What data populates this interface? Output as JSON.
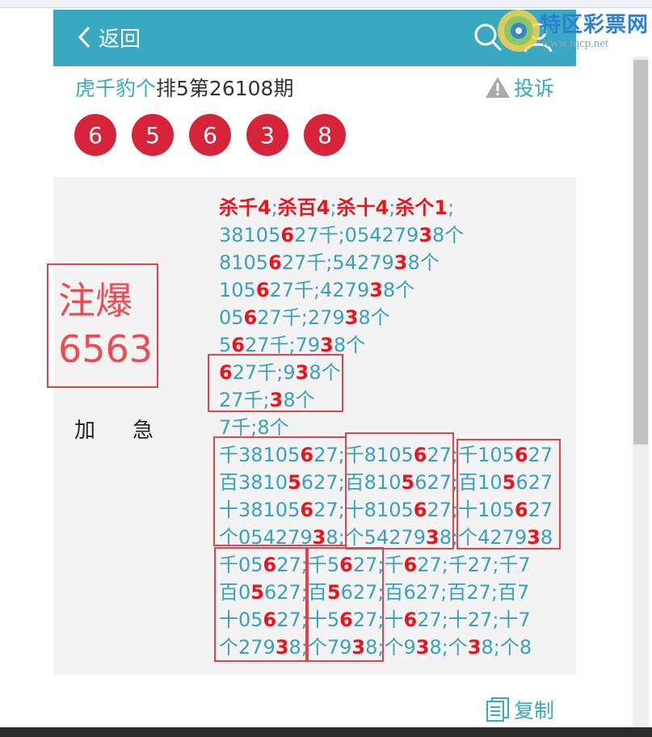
{
  "header": {
    "back_label": "返回"
  },
  "logo": {
    "name": "特区彩票网",
    "url": "www.tqcp.net"
  },
  "post": {
    "author": "虎千豹个",
    "title": "排5第26108期",
    "report_label": "投诉",
    "balls": [
      "6",
      "5",
      "6",
      "3",
      "8"
    ]
  },
  "badge": {
    "line1": "注爆",
    "line2": "6563"
  },
  "tags": [
    "加",
    "急"
  ],
  "lines": [
    [
      [
        "杀千4",
        true
      ],
      [
        ";",
        false
      ],
      [
        "杀百4",
        true
      ],
      [
        ";",
        false
      ],
      [
        "杀十4",
        true
      ],
      [
        ";",
        false
      ],
      [
        "杀个1",
        true
      ],
      [
        ";",
        false
      ]
    ],
    [
      [
        "38105",
        false
      ],
      [
        "6",
        true
      ],
      [
        "27千;054279",
        false
      ],
      [
        "3",
        true
      ],
      [
        "8个",
        false
      ]
    ],
    [
      [
        "8105",
        false
      ],
      [
        "6",
        true
      ],
      [
        "27千;54279",
        false
      ],
      [
        "3",
        true
      ],
      [
        "8个",
        false
      ]
    ],
    [
      [
        "105",
        false
      ],
      [
        "6",
        true
      ],
      [
        "27千;4279",
        false
      ],
      [
        "3",
        true
      ],
      [
        "8个",
        false
      ]
    ],
    [
      [
        "05",
        false
      ],
      [
        "6",
        true
      ],
      [
        "27千;279",
        false
      ],
      [
        "3",
        true
      ],
      [
        "8个",
        false
      ]
    ],
    [
      [
        "5",
        false
      ],
      [
        "6",
        true
      ],
      [
        "27千;79",
        false
      ],
      [
        "3",
        true
      ],
      [
        "8个",
        false
      ]
    ],
    [
      [
        "6",
        true
      ],
      [
        "27千;9",
        false
      ],
      [
        "3",
        true
      ],
      [
        "8个",
        false
      ]
    ],
    [
      [
        "27千;",
        false
      ],
      [
        "3",
        true
      ],
      [
        "8个",
        false
      ]
    ],
    [
      [
        "7千;8个",
        false
      ]
    ],
    [
      [
        "千38105",
        false
      ],
      [
        "6",
        true
      ],
      [
        "27;千8105",
        false
      ],
      [
        "6",
        true
      ],
      [
        "27;千105",
        false
      ],
      [
        "6",
        true
      ],
      [
        "27",
        false
      ]
    ],
    [
      [
        "百3810",
        false
      ],
      [
        "5",
        true
      ],
      [
        "627;百810",
        false
      ],
      [
        "5",
        true
      ],
      [
        "627;百10",
        false
      ],
      [
        "5",
        true
      ],
      [
        "627",
        false
      ]
    ],
    [
      [
        "十38105",
        false
      ],
      [
        "6",
        true
      ],
      [
        "27;十8105",
        false
      ],
      [
        "6",
        true
      ],
      [
        "27;十105",
        false
      ],
      [
        "6",
        true
      ],
      [
        "27",
        false
      ]
    ],
    [
      [
        "个054279",
        false
      ],
      [
        "3",
        true
      ],
      [
        "8;个54279",
        false
      ],
      [
        "3",
        true
      ],
      [
        "8;个4279",
        false
      ],
      [
        "3",
        true
      ],
      [
        "8",
        false
      ]
    ],
    [
      [
        "千05",
        false
      ],
      [
        "6",
        true
      ],
      [
        "27;千5",
        false
      ],
      [
        "6",
        true
      ],
      [
        "27;千",
        false
      ],
      [
        "6",
        true
      ],
      [
        "27;千27;千7",
        false
      ]
    ],
    [
      [
        "百0",
        false
      ],
      [
        "5",
        true
      ],
      [
        "627;百",
        false
      ],
      [
        "5",
        true
      ],
      [
        "627;百627;百27;百7",
        false
      ]
    ],
    [
      [
        "十05",
        false
      ],
      [
        "6",
        true
      ],
      [
        "27;十5",
        false
      ],
      [
        "6",
        true
      ],
      [
        "27;十",
        false
      ],
      [
        "6",
        true
      ],
      [
        "27;十27;十7",
        false
      ]
    ],
    [
      [
        "个279",
        false
      ],
      [
        "3",
        true
      ],
      [
        "8;个79",
        false
      ],
      [
        "3",
        true
      ],
      [
        "8;个9",
        false
      ],
      [
        "3",
        true
      ],
      [
        "8;个",
        false
      ],
      [
        "3",
        true
      ],
      [
        "8;个8",
        false
      ]
    ]
  ],
  "copy_label": "复制",
  "colors": {
    "accent": "#3aa8c1",
    "ball": "#d8243a",
    "highlight": "#e8141e",
    "box": "#e2444c"
  }
}
